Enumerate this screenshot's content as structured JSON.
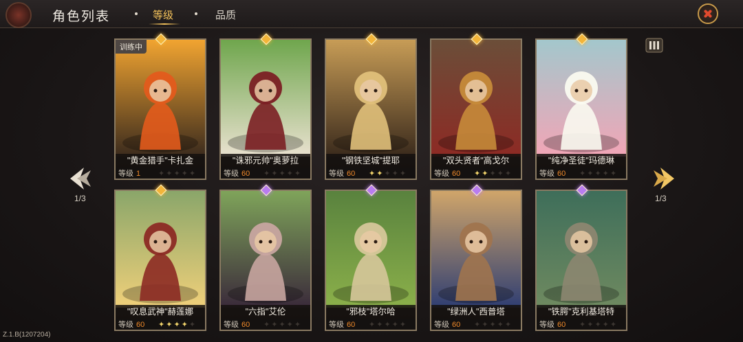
{
  "header": {
    "title": "角色列表",
    "tabs": [
      {
        "label": "等级",
        "active": true
      },
      {
        "label": "品质",
        "active": false
      }
    ]
  },
  "colors": {
    "accent": "#f5c35b",
    "level_value": "#f08a2a",
    "close_x": "#e24a2e",
    "gem_gold": "#f3b53a",
    "gem_purple": "#b97cf0"
  },
  "pagination": {
    "left": "1/3",
    "right": "1/3"
  },
  "level_label": "等级",
  "cards": [
    {
      "name": "\"黄金猎手\"卡扎金",
      "level": "1",
      "stars": 0,
      "max_stars": 5,
      "gem": "gold",
      "badge": "训练中",
      "art": "gold-mech-warrior"
    },
    {
      "name": "\"诛邪元帅\"奥萝拉",
      "level": "60",
      "stars": 0,
      "max_stars": 5,
      "gem": "gold",
      "badge": "",
      "art": "white-haired-commander"
    },
    {
      "name": "\"钢铁坚城\"提耶",
      "level": "60",
      "stars": 2,
      "max_stars": 5,
      "gem": "gold",
      "badge": "",
      "art": "golden-shield-warrior"
    },
    {
      "name": "\"双头贤者\"高戈尔",
      "level": "60",
      "stars": 2,
      "max_stars": 5,
      "gem": "gold",
      "badge": "",
      "art": "two-headed-ogre"
    },
    {
      "name": "\"纯净圣徒\"玛德琳",
      "level": "60",
      "stars": 0,
      "max_stars": 5,
      "gem": "gold",
      "badge": "",
      "art": "pink-haired-saint"
    },
    {
      "name": "\"叹息武神\"赫莲娜",
      "level": "60",
      "stars": 4,
      "max_stars": 5,
      "gem": "gold",
      "badge": "",
      "art": "blonde-war-goddess"
    },
    {
      "name": "\"六指\"艾伦",
      "level": "60",
      "stars": 0,
      "max_stars": 5,
      "gem": "purple",
      "badge": "",
      "art": "hooded-assassin"
    },
    {
      "name": "\"邪枝\"塔尔哈",
      "level": "60",
      "stars": 0,
      "max_stars": 5,
      "gem": "purple",
      "badge": "",
      "art": "goblin-shaman"
    },
    {
      "name": "\"绿洲人\"西普塔",
      "level": "60",
      "stars": 0,
      "max_stars": 5,
      "gem": "purple",
      "badge": "",
      "art": "desert-archer"
    },
    {
      "name": "\"铁腭\"克利基塔特",
      "level": "60",
      "stars": 0,
      "max_stars": 5,
      "gem": "purple",
      "badge": "",
      "art": "crocodile-brute"
    }
  ],
  "icons": {
    "close": "close-icon",
    "prev": "chevron-left-icon",
    "next": "chevron-right-icon",
    "list": "list-view-icon",
    "gem": "rarity-gem-icon",
    "star": "star-icon"
  },
  "version": "Z.1.B(1207204)"
}
